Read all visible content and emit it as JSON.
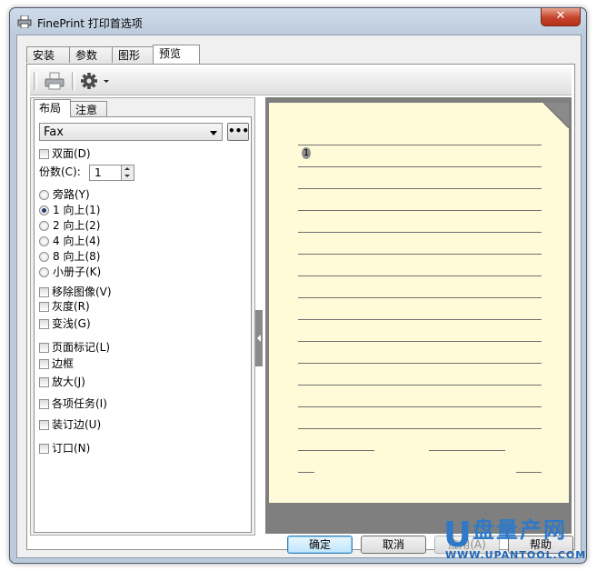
{
  "window": {
    "title": "FinePrint 打印首选项",
    "close_glyph": "✕"
  },
  "tabs": [
    {
      "label": "安装"
    },
    {
      "label": "参数"
    },
    {
      "label": "图形"
    },
    {
      "label": "预览"
    }
  ],
  "subtabs": [
    {
      "label": "布局"
    },
    {
      "label": "注意"
    }
  ],
  "toolbar": {
    "print_icon": "printer-icon",
    "settings_icon": "gear-icon"
  },
  "layout": {
    "form_select": "Fax",
    "more_button": "•••",
    "duplex_label": "双面(D)",
    "copies_label": "份数(C):",
    "copies_value": "1",
    "pages_options": [
      {
        "label": "旁路(Y)",
        "checked": false
      },
      {
        "label": "1 向上(1)",
        "checked": true
      },
      {
        "label": "2 向上(2)",
        "checked": false
      },
      {
        "label": "4 向上(4)",
        "checked": false
      },
      {
        "label": "8 向上(8)",
        "checked": false
      },
      {
        "label": "小册子(K)",
        "checked": false
      }
    ],
    "options_group1": [
      {
        "label": "移除图像(V)"
      },
      {
        "label": "灰度(R)"
      },
      {
        "label": "变浅(G)"
      }
    ],
    "options_group2": [
      {
        "label": "页面标记(L)"
      },
      {
        "label": "边框"
      },
      {
        "label": "放大(J)"
      }
    ],
    "options_group3": [
      {
        "label": "各项任务(I)"
      },
      {
        "label": "装订边(U)"
      }
    ],
    "options_group4": [
      {
        "label": "订口(N)"
      }
    ]
  },
  "preview": {
    "page_number": "1"
  },
  "buttons": {
    "ok": "确定",
    "cancel": "取消",
    "apply": "应用(A)",
    "help": "帮助"
  },
  "watermark": {
    "logo_letter": "U",
    "brand": "盘量产网",
    "url": "WWW.UPANTOOL.COM"
  },
  "colors": {
    "page_background": "#fffbd8",
    "preview_background": "#7f7f7f",
    "watermark": "#2f79c8"
  }
}
